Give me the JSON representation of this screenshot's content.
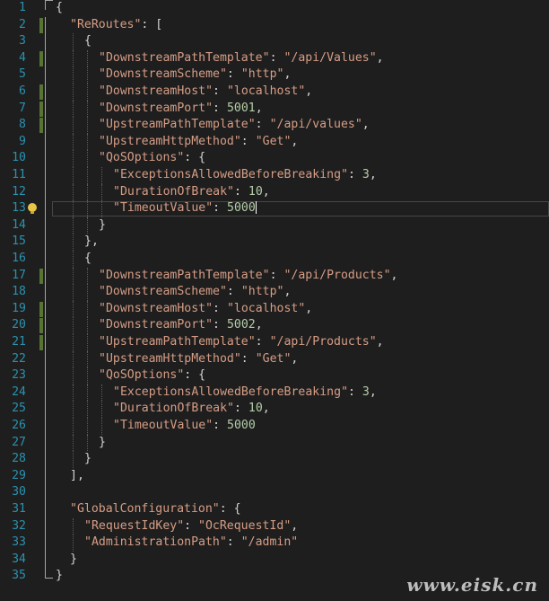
{
  "editor": {
    "lines": [
      {
        "num": "1",
        "indent": 0,
        "tokens": [
          [
            "p",
            "{"
          ]
        ],
        "fold": "open"
      },
      {
        "num": "2",
        "indent": 1,
        "tokens": [
          [
            "k",
            "\"ReRoutes\""
          ],
          [
            "p",
            ": ["
          ]
        ],
        "change": true,
        "fold": "mid"
      },
      {
        "num": "3",
        "indent": 2,
        "tokens": [
          [
            "p",
            "{"
          ]
        ],
        "fold": "mid"
      },
      {
        "num": "4",
        "indent": 3,
        "tokens": [
          [
            "k",
            "\"DownstreamPathTemplate\""
          ],
          [
            "p",
            ": "
          ],
          [
            "k",
            "\"/api/Values\""
          ],
          [
            "p",
            ","
          ]
        ],
        "change": true,
        "fold": "mid"
      },
      {
        "num": "5",
        "indent": 3,
        "tokens": [
          [
            "k",
            "\"DownstreamScheme\""
          ],
          [
            "p",
            ": "
          ],
          [
            "k",
            "\"http\""
          ],
          [
            "p",
            ","
          ]
        ],
        "fold": "mid"
      },
      {
        "num": "6",
        "indent": 3,
        "tokens": [
          [
            "k",
            "\"DownstreamHost\""
          ],
          [
            "p",
            ": "
          ],
          [
            "k",
            "\"localhost\""
          ],
          [
            "p",
            ","
          ]
        ],
        "change": true,
        "fold": "mid"
      },
      {
        "num": "7",
        "indent": 3,
        "tokens": [
          [
            "k",
            "\"DownstreamPort\""
          ],
          [
            "p",
            ": "
          ],
          [
            "n",
            "5001"
          ],
          [
            "p",
            ","
          ]
        ],
        "change": true,
        "fold": "mid"
      },
      {
        "num": "8",
        "indent": 3,
        "tokens": [
          [
            "k",
            "\"UpstreamPathTemplate\""
          ],
          [
            "p",
            ": "
          ],
          [
            "k",
            "\"/api/values\""
          ],
          [
            "p",
            ","
          ]
        ],
        "change": true,
        "fold": "mid"
      },
      {
        "num": "9",
        "indent": 3,
        "tokens": [
          [
            "k",
            "\"UpstreamHttpMethod\""
          ],
          [
            "p",
            ": "
          ],
          [
            "k",
            "\"Get\""
          ],
          [
            "p",
            ","
          ]
        ],
        "fold": "mid"
      },
      {
        "num": "10",
        "indent": 3,
        "tokens": [
          [
            "k",
            "\"QoSOptions\""
          ],
          [
            "p",
            ": {"
          ]
        ],
        "fold": "mid"
      },
      {
        "num": "11",
        "indent": 4,
        "tokens": [
          [
            "k",
            "\"ExceptionsAllowedBeforeBreaking\""
          ],
          [
            "p",
            ": "
          ],
          [
            "n",
            "3"
          ],
          [
            "p",
            ","
          ]
        ],
        "fold": "mid"
      },
      {
        "num": "12",
        "indent": 4,
        "tokens": [
          [
            "k",
            "\"DurationOfBreak\""
          ],
          [
            "p",
            ": "
          ],
          [
            "n",
            "10"
          ],
          [
            "p",
            ","
          ]
        ],
        "fold": "mid"
      },
      {
        "num": "13",
        "indent": 4,
        "tokens": [
          [
            "k",
            "\"TimeoutValue\""
          ],
          [
            "p",
            ": "
          ],
          [
            "n",
            "5000"
          ]
        ],
        "current": true,
        "caret": true,
        "bulb": true,
        "fold": "mid"
      },
      {
        "num": "14",
        "indent": 3,
        "tokens": [
          [
            "p",
            "}"
          ]
        ],
        "fold": "mid"
      },
      {
        "num": "15",
        "indent": 2,
        "tokens": [
          [
            "p",
            "},"
          ]
        ],
        "fold": "mid"
      },
      {
        "num": "16",
        "indent": 2,
        "tokens": [
          [
            "p",
            "{"
          ]
        ],
        "fold": "mid"
      },
      {
        "num": "17",
        "indent": 3,
        "tokens": [
          [
            "k",
            "\"DownstreamPathTemplate\""
          ],
          [
            "p",
            ": "
          ],
          [
            "k",
            "\"/api/Products\""
          ],
          [
            "p",
            ","
          ]
        ],
        "change": true,
        "fold": "mid"
      },
      {
        "num": "18",
        "indent": 3,
        "tokens": [
          [
            "k",
            "\"DownstreamScheme\""
          ],
          [
            "p",
            ": "
          ],
          [
            "k",
            "\"http\""
          ],
          [
            "p",
            ","
          ]
        ],
        "fold": "mid"
      },
      {
        "num": "19",
        "indent": 3,
        "tokens": [
          [
            "k",
            "\"DownstreamHost\""
          ],
          [
            "p",
            ": "
          ],
          [
            "k",
            "\"localhost\""
          ],
          [
            "p",
            ","
          ]
        ],
        "change": true,
        "fold": "mid"
      },
      {
        "num": "20",
        "indent": 3,
        "tokens": [
          [
            "k",
            "\"DownstreamPort\""
          ],
          [
            "p",
            ": "
          ],
          [
            "n",
            "5002"
          ],
          [
            "p",
            ","
          ]
        ],
        "change": true,
        "fold": "mid"
      },
      {
        "num": "21",
        "indent": 3,
        "tokens": [
          [
            "k",
            "\"UpstreamPathTemplate\""
          ],
          [
            "p",
            ": "
          ],
          [
            "k",
            "\"/api/Products\""
          ],
          [
            "p",
            ","
          ]
        ],
        "change": true,
        "fold": "mid"
      },
      {
        "num": "22",
        "indent": 3,
        "tokens": [
          [
            "k",
            "\"UpstreamHttpMethod\""
          ],
          [
            "p",
            ": "
          ],
          [
            "k",
            "\"Get\""
          ],
          [
            "p",
            ","
          ]
        ],
        "fold": "mid"
      },
      {
        "num": "23",
        "indent": 3,
        "tokens": [
          [
            "k",
            "\"QoSOptions\""
          ],
          [
            "p",
            ": {"
          ]
        ],
        "fold": "mid"
      },
      {
        "num": "24",
        "indent": 4,
        "tokens": [
          [
            "k",
            "\"ExceptionsAllowedBeforeBreaking\""
          ],
          [
            "p",
            ": "
          ],
          [
            "n",
            "3"
          ],
          [
            "p",
            ","
          ]
        ],
        "fold": "mid"
      },
      {
        "num": "25",
        "indent": 4,
        "tokens": [
          [
            "k",
            "\"DurationOfBreak\""
          ],
          [
            "p",
            ": "
          ],
          [
            "n",
            "10"
          ],
          [
            "p",
            ","
          ]
        ],
        "fold": "mid"
      },
      {
        "num": "26",
        "indent": 4,
        "tokens": [
          [
            "k",
            "\"TimeoutValue\""
          ],
          [
            "p",
            ": "
          ],
          [
            "n",
            "5000"
          ]
        ],
        "fold": "mid"
      },
      {
        "num": "27",
        "indent": 3,
        "tokens": [
          [
            "p",
            "}"
          ]
        ],
        "fold": "mid"
      },
      {
        "num": "28",
        "indent": 2,
        "tokens": [
          [
            "p",
            "}"
          ]
        ],
        "fold": "mid"
      },
      {
        "num": "29",
        "indent": 1,
        "tokens": [
          [
            "p",
            "],"
          ]
        ],
        "fold": "mid"
      },
      {
        "num": "30",
        "indent": 0,
        "tokens": [],
        "fold": "mid"
      },
      {
        "num": "31",
        "indent": 1,
        "tokens": [
          [
            "k",
            "\"GlobalConfiguration\""
          ],
          [
            "p",
            ": {"
          ]
        ],
        "fold": "mid"
      },
      {
        "num": "32",
        "indent": 2,
        "tokens": [
          [
            "k",
            "\"RequestIdKey\""
          ],
          [
            "p",
            ": "
          ],
          [
            "k",
            "\"OcRequestId\""
          ],
          [
            "p",
            ","
          ]
        ],
        "fold": "mid"
      },
      {
        "num": "33",
        "indent": 2,
        "tokens": [
          [
            "k",
            "\"AdministrationPath\""
          ],
          [
            "p",
            ": "
          ],
          [
            "k",
            "\"/admin\""
          ]
        ],
        "fold": "mid"
      },
      {
        "num": "34",
        "indent": 1,
        "tokens": [
          [
            "p",
            "}"
          ]
        ],
        "fold": "mid"
      },
      {
        "num": "35",
        "indent": 0,
        "tokens": [
          [
            "p",
            "}"
          ]
        ],
        "fold": "close"
      }
    ]
  },
  "watermark": {
    "text": "www.eisk.cn"
  },
  "colors": {
    "string": "#d69d85",
    "number": "#b5cea8",
    "line_number": "#2b91af",
    "change_bar": "#577430",
    "background": "#1e1e1e"
  }
}
